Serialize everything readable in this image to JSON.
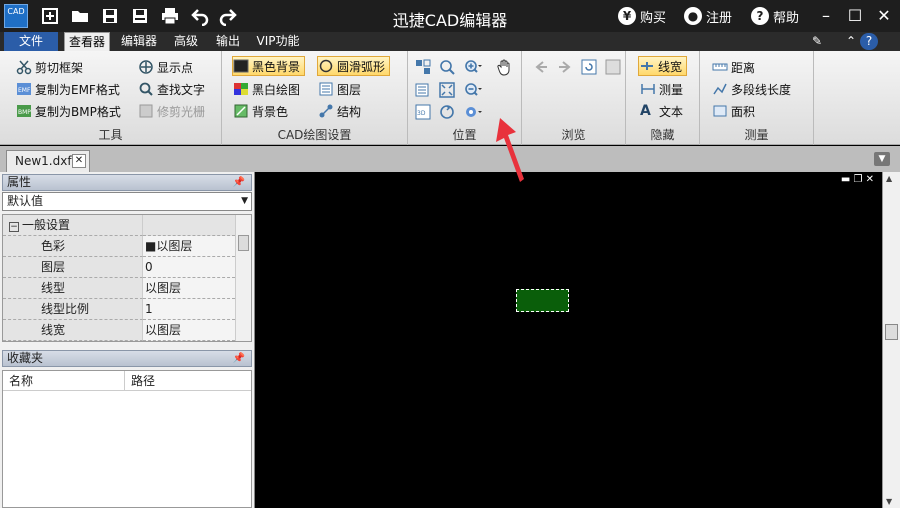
{
  "app": {
    "logo_text": "CAD",
    "title": "迅捷CAD编辑器",
    "links": [
      {
        "label": "购买",
        "icon": "yen-icon",
        "glyph": "¥"
      },
      {
        "label": "注册",
        "icon": "user-icon",
        "glyph": "●"
      },
      {
        "label": "帮助",
        "icon": "help-icon",
        "glyph": "?"
      }
    ]
  },
  "menu": {
    "file": "文件",
    "tabs": [
      "查看器",
      "编辑器",
      "高级",
      "输出",
      "VIP功能"
    ],
    "active_tab": "查看器"
  },
  "ribbon": {
    "tools": {
      "label": "工具",
      "buttons": [
        "剪切框架",
        "复制为EMF格式",
        "复制为BMP格式",
        "显示点",
        "查找文字",
        "修剪光栅"
      ]
    },
    "cad_settings": {
      "label": "CAD绘图设置",
      "buttons": [
        "黑色背景",
        "黑白绘图",
        "背景色",
        "圆滑弧形",
        "图层",
        "结构"
      ]
    },
    "position": {
      "label": "位置"
    },
    "browse": {
      "label": "浏览"
    },
    "hide": {
      "label": "隐藏",
      "buttons": [
        "线宽",
        "测量",
        "文本"
      ]
    },
    "measure": {
      "label": "测量",
      "buttons": [
        "距离",
        "多段线长度",
        "面积"
      ]
    }
  },
  "document": {
    "tab": "New1.dxf"
  },
  "properties": {
    "title": "属性",
    "selector": "默认值",
    "category": "一般设置",
    "rows": [
      {
        "name": "色彩",
        "value": "■以图层"
      },
      {
        "name": "图层",
        "value": "0"
      },
      {
        "name": "线型",
        "value": "以图层"
      },
      {
        "name": "线型比例",
        "value": "1"
      },
      {
        "name": "线宽",
        "value": "以图层"
      }
    ]
  },
  "favorites": {
    "title": "收藏夹",
    "columns": [
      "名称",
      "路径"
    ]
  },
  "colors": {
    "titlebar": "#1e1e1e",
    "file_tab": "#2b5da8",
    "shape_fill": "#0a5e0a",
    "arrow": "#e8323c"
  }
}
